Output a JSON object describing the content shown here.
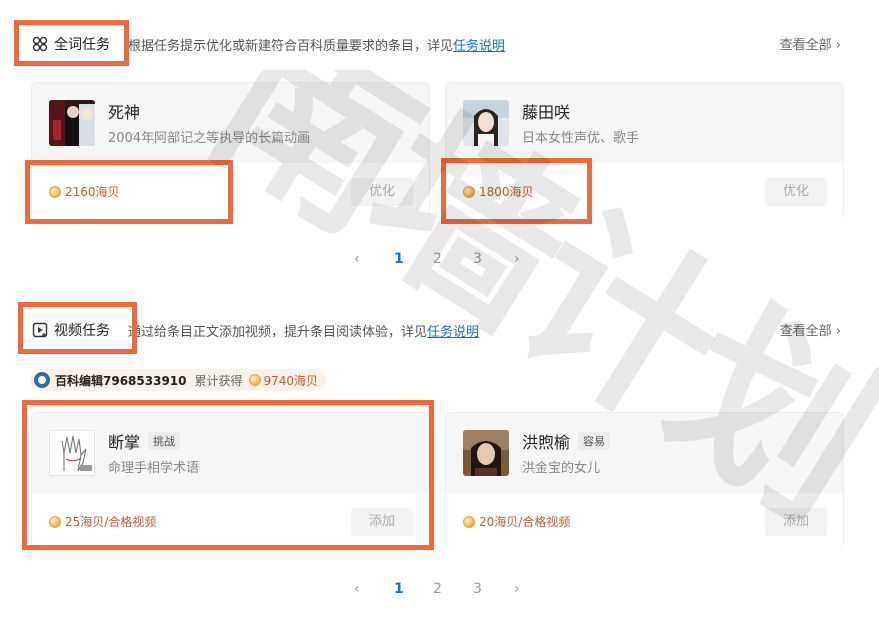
{
  "sections": {
    "full_word": {
      "title": "全词任务",
      "desc_prefix": "根据任务提示优化或新建符合百科质量要求的条目，详见",
      "desc_link": "任务说明",
      "see_all": "查看全部",
      "cards": [
        {
          "title": "死神",
          "subtitle": "2004年阿部记之等执导的长篇动画",
          "reward": "2160海贝",
          "button": "优化"
        },
        {
          "title": "藤田咲",
          "subtitle": "日本女性声优、歌手",
          "reward": "1800海贝",
          "button": "优化"
        }
      ],
      "pager": {
        "prev": "‹",
        "pages": [
          "1",
          "2",
          "3"
        ],
        "next": "›",
        "current": "1"
      }
    },
    "video": {
      "title": "视频任务",
      "desc_prefix": "通过给条目正文添加视频，提升条目阅读体验，详见",
      "desc_link": "任务说明",
      "see_all": "查看全部",
      "user": {
        "name": "百科编辑7968533910",
        "earned_label": "累计获得",
        "earned": "9740海贝"
      },
      "cards": [
        {
          "title": "断掌",
          "tag": "挑战",
          "subtitle": "命理手相学术语",
          "reward": "25海贝/合格视频",
          "button": "添加"
        },
        {
          "title": "洪煦榆",
          "tag": "容易",
          "subtitle": "洪金宝的女儿",
          "reward": "20海贝/合格视频",
          "button": "添加"
        }
      ],
      "pager": {
        "prev": "‹",
        "pages": [
          "1",
          "2",
          "3"
        ],
        "next": "›",
        "current": "1"
      }
    }
  },
  "watermark": "南墙计划",
  "colors": {
    "highlight": "#ee6a3c",
    "link": "#1e6fc4",
    "reward": "#c05e2f"
  }
}
